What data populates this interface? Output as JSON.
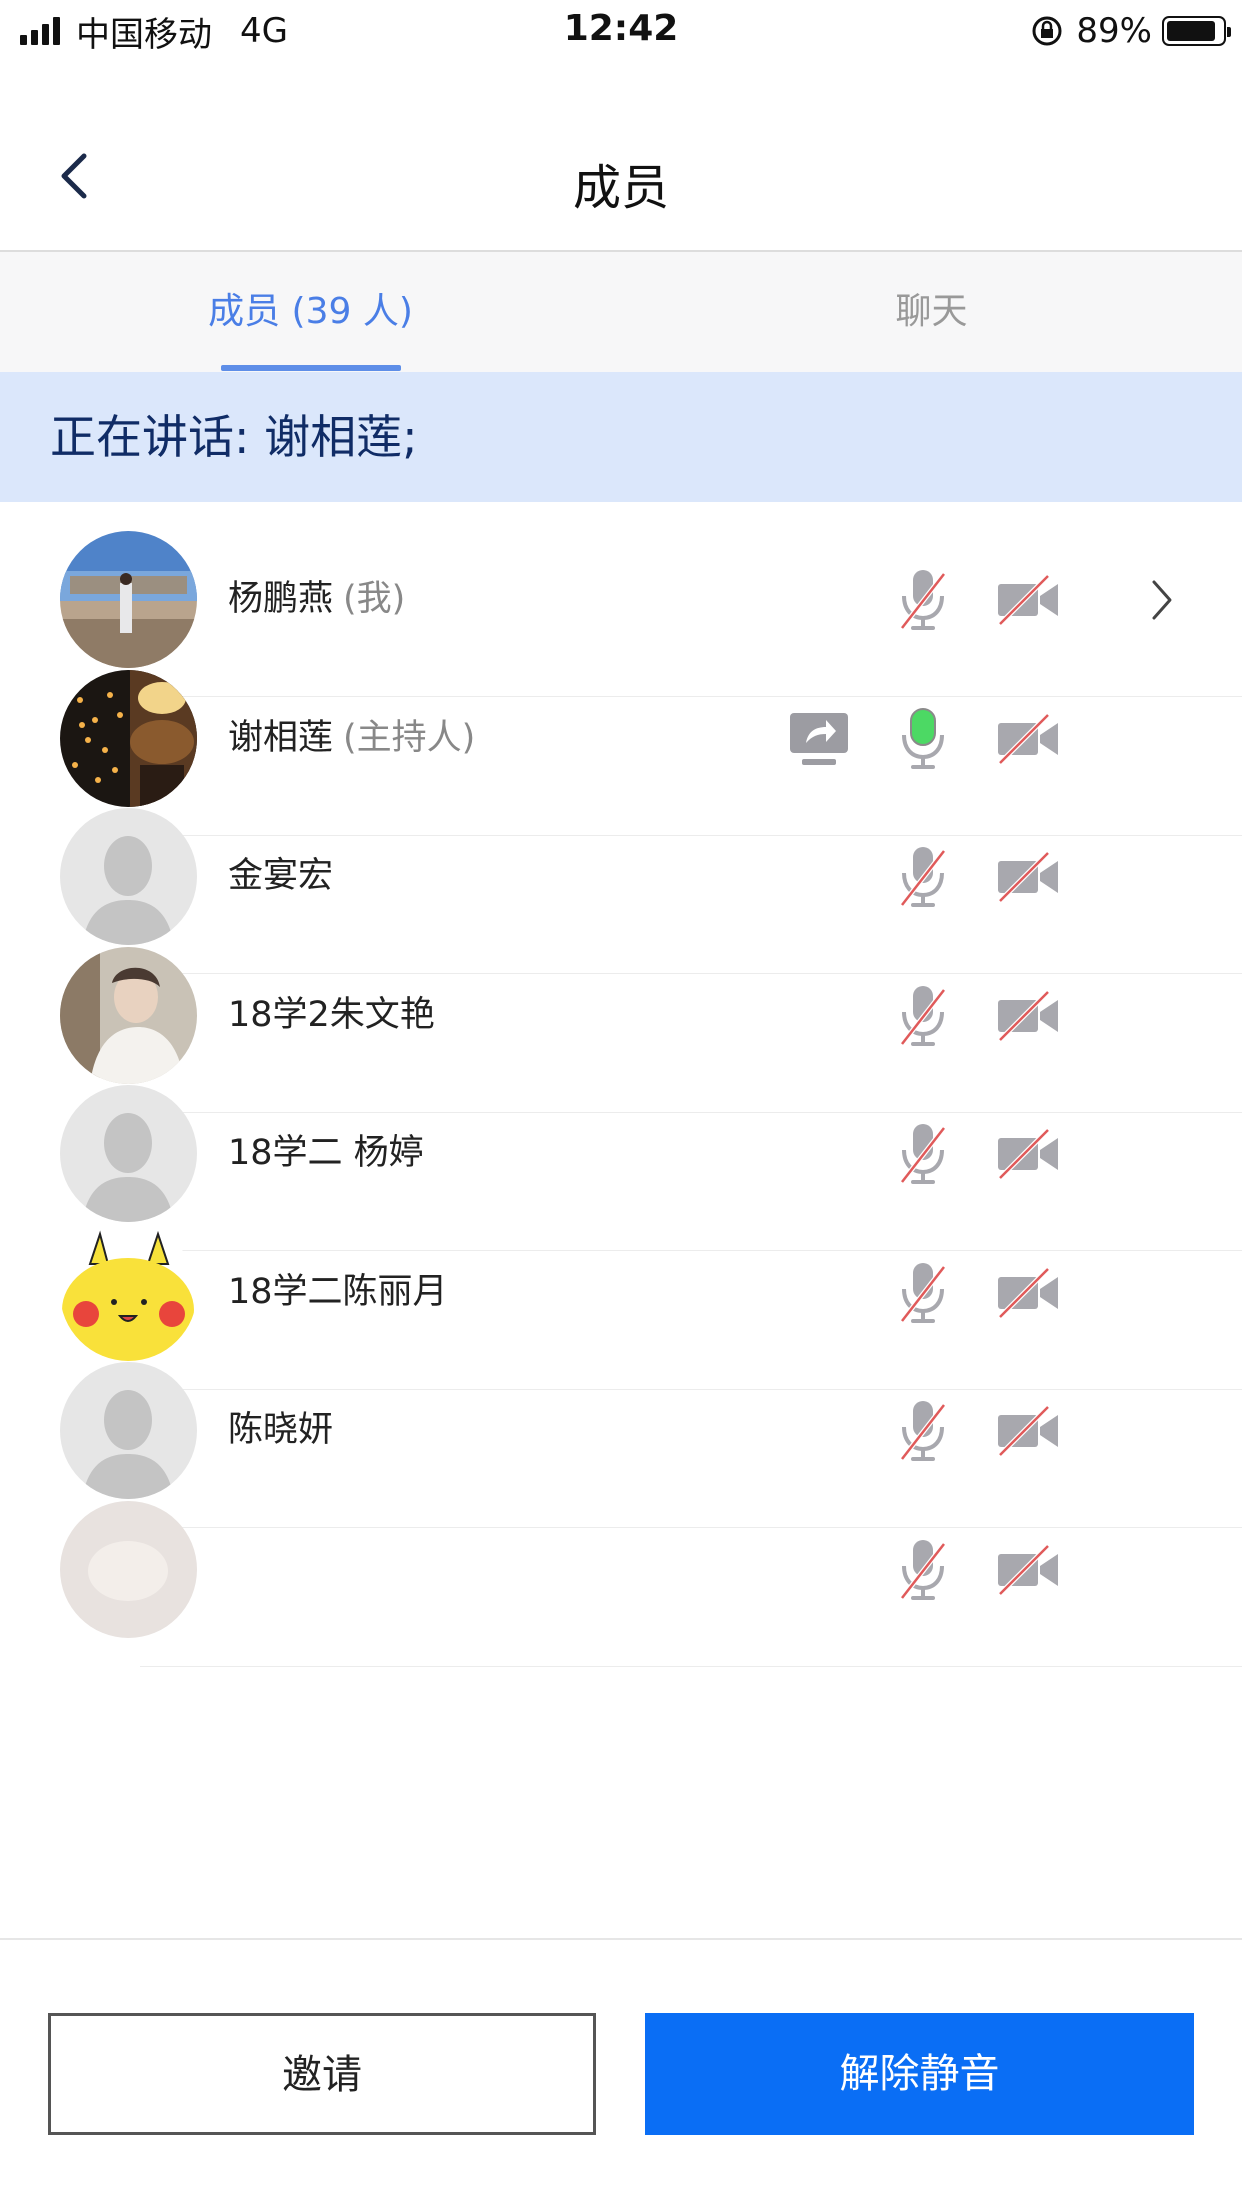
{
  "status_bar": {
    "carrier": "中国移动",
    "network": "4G",
    "time": "12:42",
    "battery_percent": "89%",
    "battery_level": 0.89
  },
  "nav": {
    "title": "成员",
    "back_icon": "chevron-left-icon"
  },
  "tabs": [
    {
      "label": "成员 (39 人)",
      "active": true
    },
    {
      "label": "聊天",
      "active": false
    }
  ],
  "speaking": {
    "text": "正在讲话: 谢相莲;"
  },
  "members": [
    {
      "name": "杨鹏燕",
      "role": "(我)",
      "avatar": "photo-landscape",
      "mic": "muted",
      "camera": "off",
      "sharing": false,
      "chevron": true
    },
    {
      "name": "谢相莲",
      "role": "(主持人)",
      "avatar": "photo-lanterns",
      "mic": "speaking",
      "camera": "off",
      "sharing": true,
      "chevron": false
    },
    {
      "name": " 金宴宏",
      "role": "",
      "avatar": "default",
      "mic": "muted",
      "camera": "off",
      "sharing": false,
      "chevron": false
    },
    {
      "name": "18学2朱文艳",
      "role": "",
      "avatar": "photo-portrait",
      "mic": "muted",
      "camera": "off",
      "sharing": false,
      "chevron": false
    },
    {
      "name": "18学二 杨婷",
      "role": "",
      "avatar": "default",
      "mic": "muted",
      "camera": "off",
      "sharing": false,
      "chevron": false
    },
    {
      "name": "18学二陈丽月",
      "role": "",
      "avatar": "cartoon-yellow",
      "mic": "muted",
      "camera": "off",
      "sharing": false,
      "chevron": false
    },
    {
      "name": "陈晓妍",
      "role": "",
      "avatar": "default",
      "mic": "muted",
      "camera": "off",
      "sharing": false,
      "chevron": false
    },
    {
      "name": "",
      "role": "",
      "avatar": "photo-partial",
      "mic": "muted",
      "camera": "off",
      "sharing": false,
      "chevron": false
    }
  ],
  "buttons": {
    "invite": "邀请",
    "unmute": "解除静音"
  },
  "colors": {
    "accent": "#0a6ef5",
    "tab_active": "#4a7ee6",
    "banner_bg": "#dbe7fb",
    "mute_slash": "#e05a5a",
    "speaking_green": "#4cd964"
  }
}
